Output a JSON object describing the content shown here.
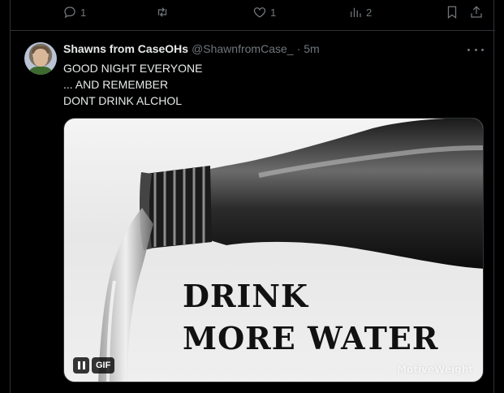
{
  "previous_tweet": {
    "actions": {
      "reply_count": "1",
      "retweet_count": "",
      "like_count": "1",
      "view_count": "2"
    }
  },
  "tweet": {
    "display_name": "Shawns from CaseOHs",
    "handle": "@ShawnfromCase_",
    "separator": "·",
    "time": "5m",
    "text": "GOOD NIGHT EVERYONE\n... AND REMEMBER\nDONT DRINK ALCHOL",
    "media": {
      "type": "gif",
      "overlay_line1": "DRINK",
      "overlay_line2": "MORE WATER",
      "watermark": "MotiveWeight",
      "gif_label": "GIF"
    }
  },
  "icons": [
    "reply-icon",
    "retweet-icon",
    "like-icon",
    "views-icon",
    "bookmark-icon",
    "share-icon",
    "more-icon",
    "pause-icon"
  ],
  "colors": {
    "background": "#000000",
    "text_primary": "#e7e9ea",
    "text_secondary": "#71767b",
    "border": "#2f3336"
  }
}
